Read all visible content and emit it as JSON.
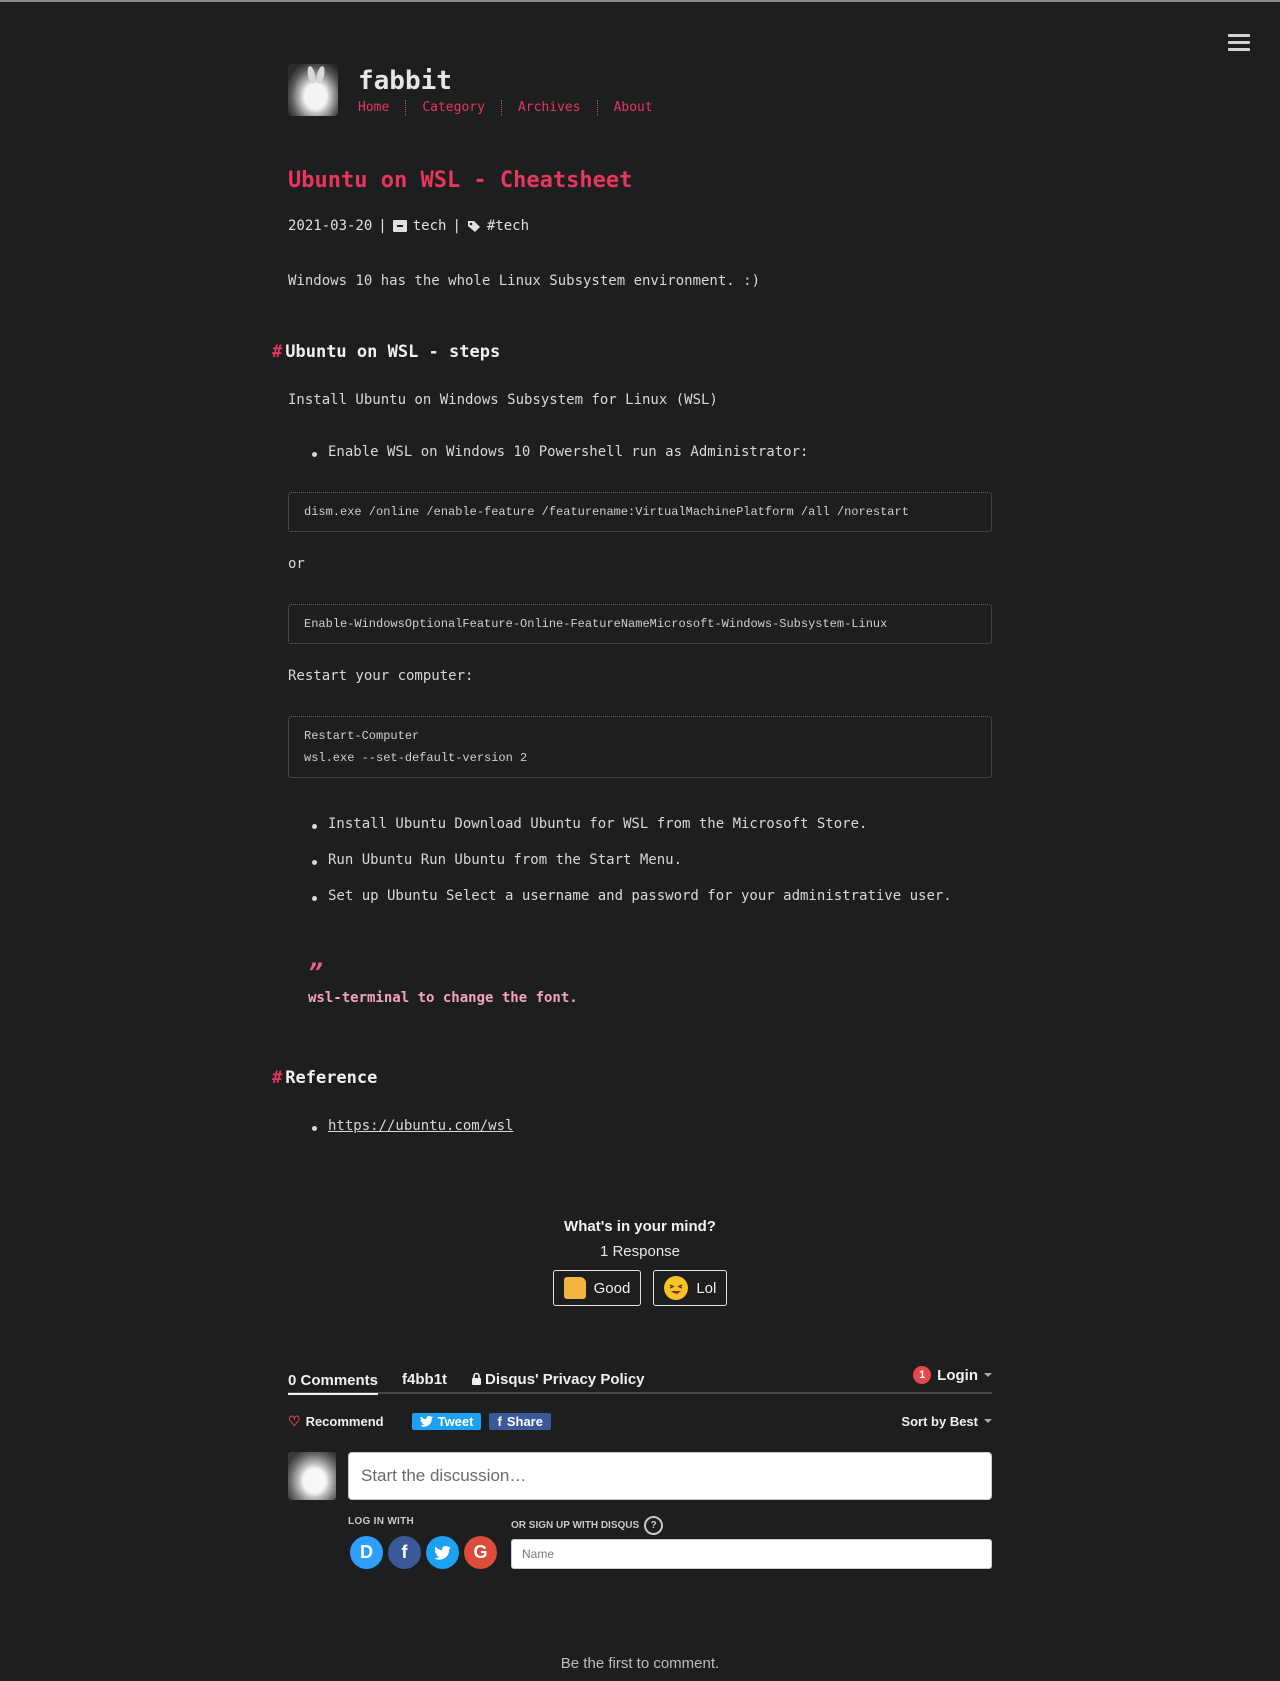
{
  "site": {
    "name": "fabbit",
    "nav": [
      "Home",
      "Category",
      "Archives",
      "About"
    ]
  },
  "post": {
    "title": "Ubuntu on WSL - Cheatsheet",
    "date": "2021-03-20",
    "category": "tech",
    "tag": "#tech",
    "intro": "Windows 10 has the whole Linux Subsystem environment. :)"
  },
  "section1": {
    "hash": "#",
    "heading": "Ubuntu on WSL - steps",
    "lead": "Install Ubuntu on Windows Subsystem for Linux (WSL)",
    "bullet1": "Enable WSL on Windows 10 Powershell run as Administrator:",
    "code1": "dism.exe /online /enable-feature /featurename:VirtualMachinePlatform /all /norestart",
    "or": "or",
    "code2": "Enable-WindowsOptionalFeature-Online-FeatureNameMicrosoft-Windows-Subsystem-Linux",
    "restart": "Restart your computer:",
    "code3_line1": "Restart-Computer",
    "code3_line2": "wsl.exe --set-default-version 2",
    "bullets": [
      "Install Ubuntu Download Ubuntu for WSL from the Microsoft Store.",
      "Run Ubuntu Run Ubuntu from the Start Menu.",
      "Set up Ubuntu Select a username and password for your administrative user."
    ],
    "quote_mark": "”",
    "quote": "wsl-terminal to change the font."
  },
  "section2": {
    "hash": "#",
    "heading": "Reference",
    "link": "https://ubuntu.com/wsl"
  },
  "reactions": {
    "question": "What's in your mind?",
    "responses": "1 Response",
    "good": "Good",
    "lol": "Lol"
  },
  "disqus": {
    "tab_comments": "0 Comments",
    "tab_site": "f4bb1t",
    "tab_privacy": "Disqus' Privacy Policy",
    "login_badge": "1",
    "login": "Login",
    "recommend": "Recommend",
    "tweet": "Tweet",
    "share": "Share",
    "sort": "Sort by Best",
    "placeholder": "Start the discussion…",
    "log_in_with": "LOG IN WITH",
    "signup": "OR SIGN UP WITH DISQUS",
    "qmark": "?",
    "name_placeholder": "Name",
    "social": [
      "D",
      "f",
      "t",
      "G"
    ],
    "first": "Be the first to comment."
  },
  "colors": {
    "accent": "#e8365d",
    "background": "#1d1e20",
    "quote": "#f5a3bd",
    "disqus": "#2e9fff",
    "facebook": "#3b5998",
    "twitter": "#1da1f2",
    "google": "#dd4b39"
  }
}
